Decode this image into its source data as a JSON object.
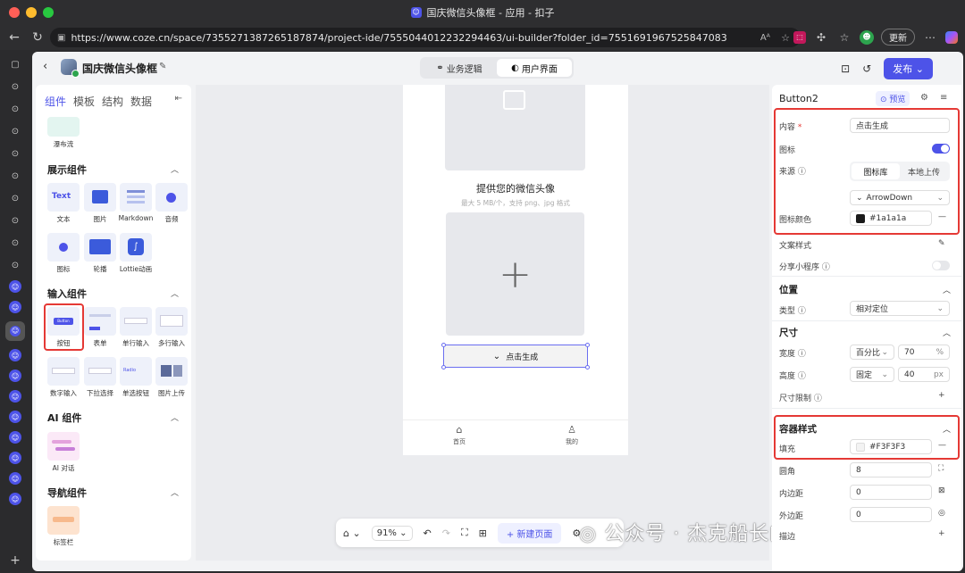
{
  "window": {
    "title": "国庆微信头像框 - 应用 - 扣子"
  },
  "browser": {
    "url": "https://www.coze.cn/space/7355271387265187874/project-ide/7555044012232294463/ui-builder?folder_id=7551691967525847083",
    "update_label": "更新",
    "reader_label": "Aᴬ"
  },
  "header": {
    "project_name": "国庆微信头像框",
    "tab_logic": "业务逻辑",
    "tab_ui": "用户界面",
    "publish_label": "发布"
  },
  "left": {
    "tabs": [
      "组件",
      "模板",
      "结构",
      "数据"
    ],
    "waterfall_label": "瀑布流",
    "sections": {
      "display": "展示组件",
      "input": "输入组件",
      "ai": "AI 组件",
      "nav": "导航组件"
    },
    "display_items": [
      "文本",
      "图片",
      "Markdown",
      "音频",
      "图标",
      "轮播",
      "Lottie动画"
    ],
    "input_items": [
      "按钮",
      "表单",
      "单行输入",
      "多行输入",
      "数字输入",
      "下拉选择",
      "单选按钮",
      "图片上传"
    ],
    "ai_items": [
      "AI 对话"
    ],
    "nav_items": [
      "标签栏"
    ],
    "thumb_text": {
      "text": "Text",
      "button": "Button",
      "radio": "Radio"
    }
  },
  "canvas": {
    "phone_title": "提供您的微信头像",
    "phone_sub": "最大 5 MB/个，支持 png、jpg 格式",
    "button_label": "点击生成",
    "tabbar": [
      "首页",
      "我的"
    ],
    "zoom": "91%",
    "new_page": "新建页面"
  },
  "watermark": "公众号 · 杰克船长的AIGC",
  "props": {
    "component_name": "Button2",
    "preview_label": "预览",
    "content_label": "内容",
    "content_value": "点击生成",
    "icon_label": "图标",
    "icon_enabled": true,
    "source_label": "来源",
    "source_options": [
      "图标库",
      "本地上传"
    ],
    "icon_value": "ArrowDown",
    "icon_color_label": "图标颜色",
    "icon_color": "#1a1a1a",
    "text_style_label": "文案样式",
    "share_label": "分享小程序",
    "share_enabled": false,
    "position_section": "位置",
    "type_label": "类型",
    "type_value": "相对定位",
    "size_section": "尺寸",
    "width_label": "宽度",
    "width_mode": "百分比",
    "width_value": "70",
    "width_unit": "%",
    "height_label": "高度",
    "height_mode": "固定",
    "height_value": "40",
    "height_unit": "px",
    "size_limit_label": "尺寸限制",
    "container_section": "容器样式",
    "fill_label": "填充",
    "fill_value": "#F3F3F3",
    "radius_label": "圆角",
    "radius_value": "8",
    "padding_label": "内边距",
    "padding_value": "0",
    "margin_label": "外边距",
    "margin_value": "0",
    "border_label": "描边"
  },
  "colors": {
    "accent": "#4d53e8",
    "highlight": "#e53935"
  }
}
